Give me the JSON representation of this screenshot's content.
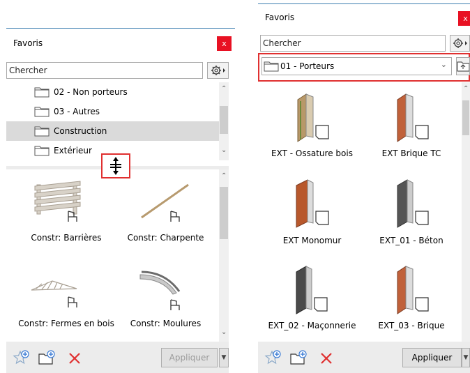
{
  "left_panel": {
    "title": "Favoris",
    "close_label": "x",
    "search_value": "Chercher",
    "folders": [
      {
        "label": "02 - Non porteurs",
        "selected": false
      },
      {
        "label": "03 - Autres",
        "selected": false
      },
      {
        "label": "Construction",
        "selected": true
      },
      {
        "label": "Extérieur",
        "selected": false
      }
    ],
    "items": [
      {
        "label": "Constr: Barrières",
        "icon": "fence-icon"
      },
      {
        "label": "Constr: Charpente",
        "icon": "beam-icon"
      },
      {
        "label": "Constr: Fermes en bois",
        "icon": "truss-icon"
      },
      {
        "label": "Constr: Moulures",
        "icon": "molding-icon"
      }
    ],
    "apply_label": "Appliquer"
  },
  "right_panel": {
    "title": "Favoris",
    "close_label": "x",
    "search_value": "Chercher",
    "folder_select": "01 - Porteurs",
    "items": [
      {
        "label": "EXT - Ossature bois",
        "color": "#b89868"
      },
      {
        "label": "EXT Brique TC",
        "color": "#c0613a"
      },
      {
        "label": "EXT Monomur",
        "color": "#b8582c"
      },
      {
        "label": "EXT_01 - Béton",
        "color": "#555555"
      },
      {
        "label": "EXT_02 - Maçonnerie",
        "color": "#4a4a4a"
      },
      {
        "label": "EXT_03 - Brique",
        "color": "#c0613a"
      }
    ],
    "apply_label": "Appliquer"
  },
  "colors": {
    "accent": "#3c7fb1",
    "close": "#e81123",
    "highlight": "#e03030",
    "delete": "#e03030"
  }
}
